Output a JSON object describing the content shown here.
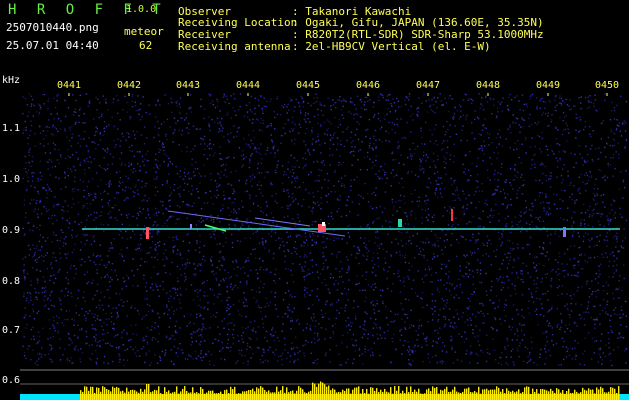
{
  "header": {
    "app_title": "H R O F F T",
    "app_version": "1.0.0",
    "file_name": "2507010440.png",
    "mode_label": "meteor",
    "date_time": "25.07.01 04:40",
    "count_value": "62"
  },
  "station_info": [
    {
      "key": "Observer",
      "value": ": Takanori Kawachi"
    },
    {
      "key": "Receiving Location",
      "value": ": Ogaki, Gifu, JAPAN (136.60E, 35.35N)"
    },
    {
      "key": "Receiver",
      "value": ": R820T2(RTL-SDR) SDR-Sharp 53.1000MHz"
    },
    {
      "key": "Receiving antenna",
      "value": ": 2el-HB9CV Vertical (el. E-W)"
    }
  ],
  "axes": {
    "unit_label": "kHz",
    "time_ticks": [
      "0441",
      "0442",
      "0443",
      "0444",
      "0445",
      "0446",
      "0447",
      "0448",
      "0449",
      "0450"
    ],
    "freq_ticks": [
      "1.1",
      "1.0",
      "0.9",
      "0.8",
      "0.7",
      "0.6"
    ]
  },
  "colors": {
    "background": "#000000",
    "noise": "#1a1a6e",
    "carrier": "#33ddcc",
    "meteor": "#ff5566",
    "level_bars": "#ffee00",
    "level_base": "#00e5ff",
    "text_yellow": "#ffff55"
  }
}
